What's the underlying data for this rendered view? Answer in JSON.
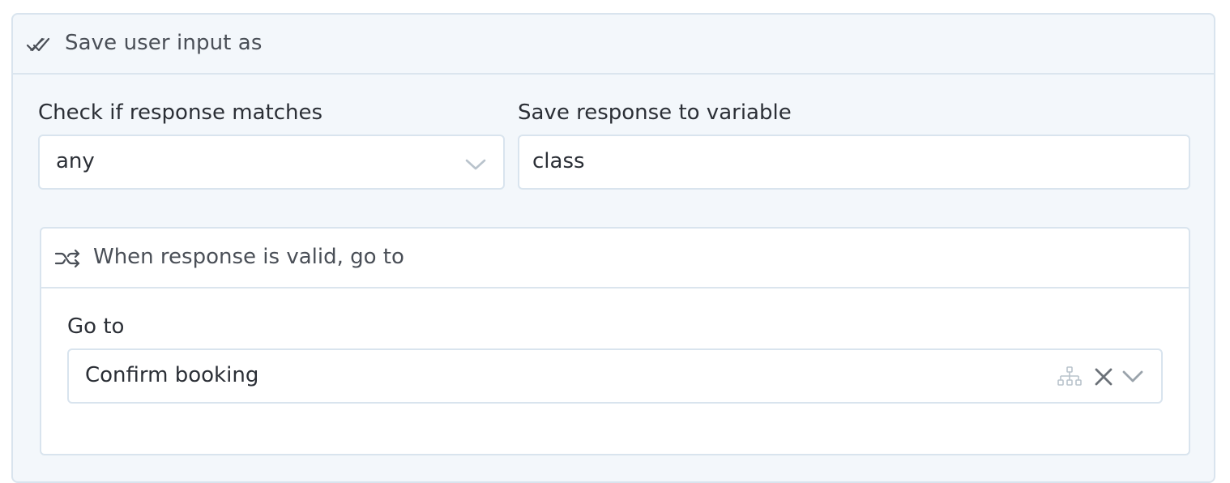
{
  "panel": {
    "title": "Save user input as",
    "icon": "double-check-icon"
  },
  "match_field": {
    "label": "Check if response matches",
    "value": "any"
  },
  "variable_field": {
    "label": "Save response to variable",
    "value": "class"
  },
  "valid_section": {
    "title": "When response is valid, go to",
    "icon": "route-branch-icon",
    "goto_label": "Go to",
    "goto_value": "Confirm booking",
    "icons": [
      "flow-tree-icon",
      "clear-icon",
      "chevron-down-icon"
    ]
  },
  "colors": {
    "panel_bg": "#f3f7fb",
    "border": "#d9e4ee",
    "text": "#2b2f36",
    "muted_text": "#4a4f57",
    "icon_muted": "#b9c3cc"
  }
}
